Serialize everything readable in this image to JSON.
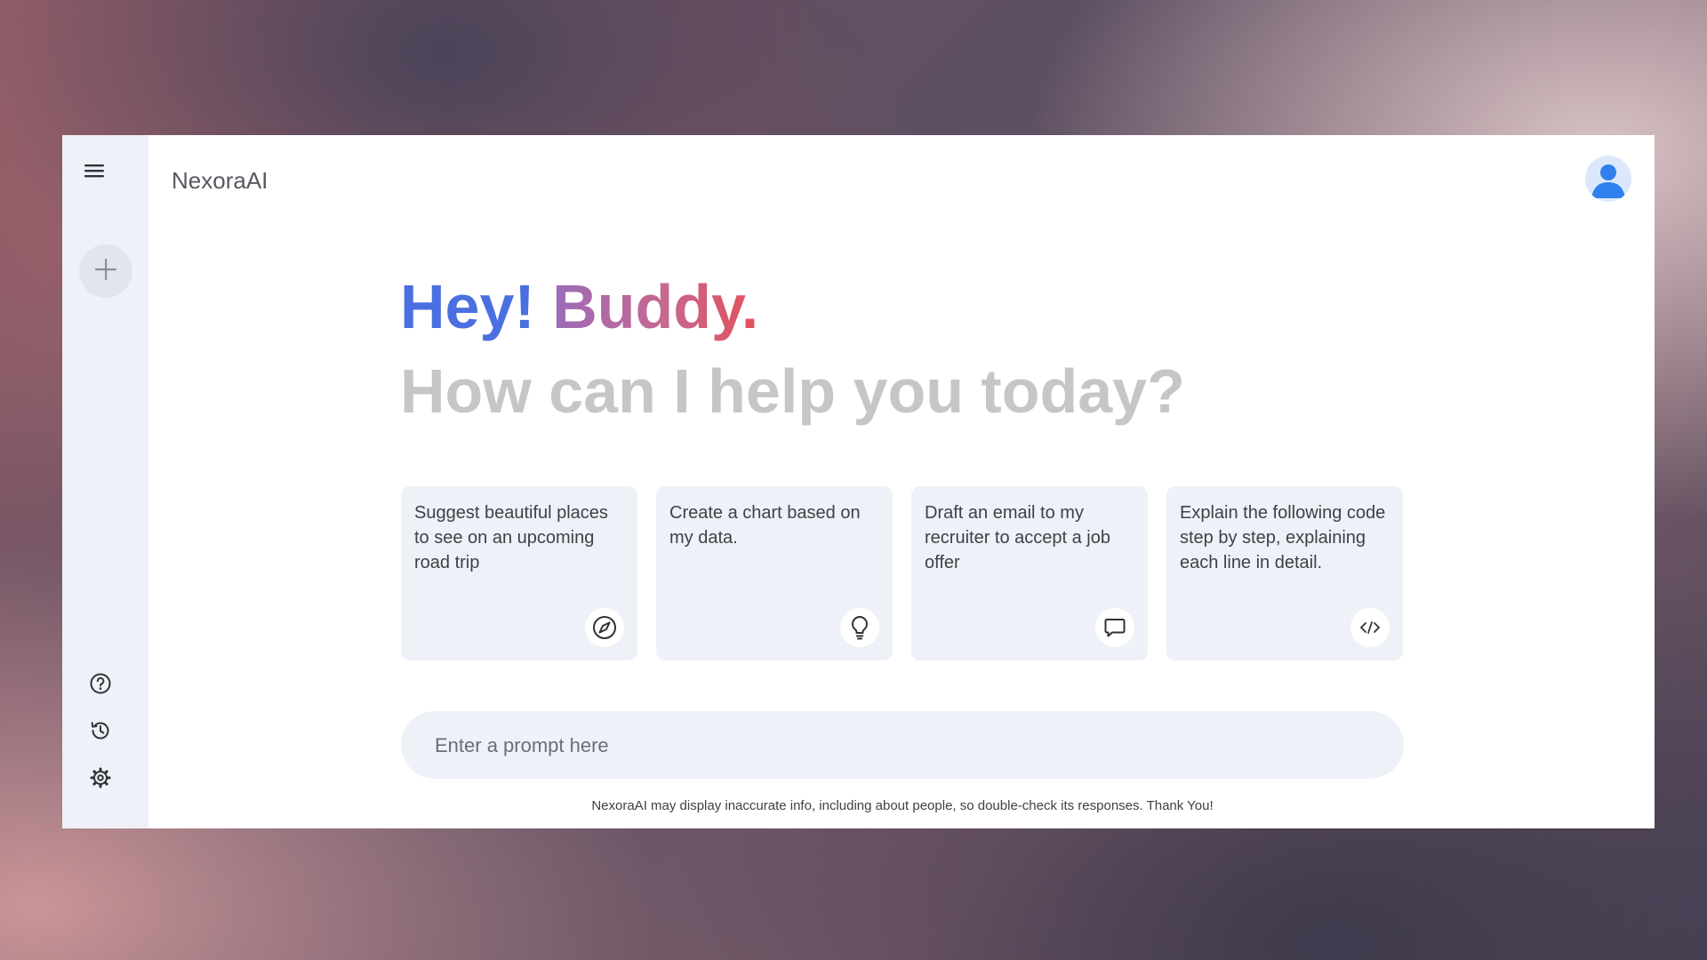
{
  "app": {
    "title": "NexoraAI"
  },
  "sidebar": {
    "menu_icon": "hamburger-menu-icon",
    "new_chat_icon": "plus-icon",
    "bottom_items": [
      {
        "icon": "help-icon"
      },
      {
        "icon": "history-icon"
      },
      {
        "icon": "settings-icon"
      }
    ]
  },
  "header": {
    "avatar_icon": "user-avatar-icon"
  },
  "greeting": {
    "hey": "Hey!",
    "buddy": "Buddy.",
    "subtitle": "How can I help you today?"
  },
  "cards": [
    {
      "text": "Suggest beautiful places to see on an upcoming road trip",
      "icon": "compass-icon"
    },
    {
      "text": "Create a chart based on my data.",
      "icon": "bulb-icon"
    },
    {
      "text": "Draft an email to my recruiter to accept a job offer",
      "icon": "message-icon"
    },
    {
      "text": "Explain the following code step by step, explaining each line in detail.",
      "icon": "code-icon"
    }
  ],
  "prompt": {
    "placeholder": "Enter a prompt here",
    "value": ""
  },
  "footer": {
    "disclaimer": "NexoraAI may display inaccurate info, including about people, so double-check its responses. Thank You!"
  },
  "colors": {
    "accent_blue": "#4b6fe0",
    "accent_red": "#e4505a",
    "panel_bg": "#eef1f7",
    "muted_text": "#c4c7c5"
  }
}
